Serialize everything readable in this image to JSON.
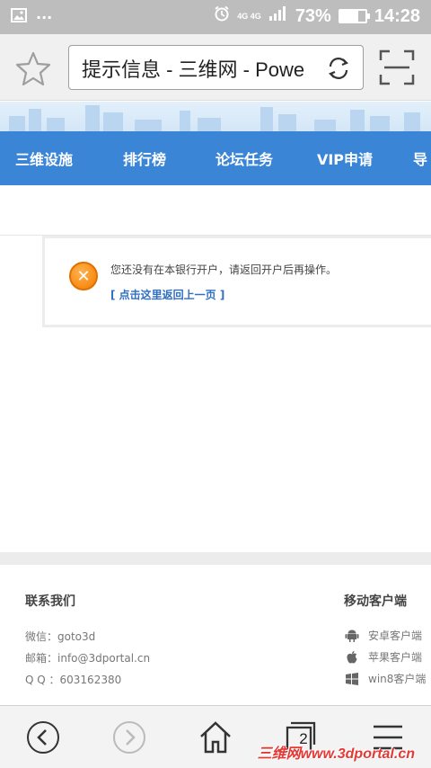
{
  "status": {
    "network": "4G 4G",
    "battery": "73%",
    "battery_level": 0.73,
    "time": "14:28"
  },
  "browser": {
    "title": "提示信息 - 三维网 - Powe",
    "tab_count": "2"
  },
  "nav": {
    "items": [
      "三维设施",
      "排行榜",
      "论坛任务",
      "VIP申请",
      "导"
    ]
  },
  "message": {
    "text": "您还没有在本银行开户，请返回开户后再操作。",
    "link": "[ 点击这里返回上一页 ]"
  },
  "footer": {
    "contact_title": "联系我们",
    "contacts": [
      "微信：goto3d",
      "邮箱：info@3dportal.cn",
      "Q Q ：603162380"
    ],
    "mobile_title": "移动客户端",
    "clients": [
      {
        "label": "安卓客户端",
        "icon": "android-icon"
      },
      {
        "label": "苹果客户端",
        "icon": "apple-icon"
      },
      {
        "label": "win8客户端",
        "icon": "windows-icon"
      }
    ]
  },
  "watermark": "三维网www.3dportal.cn",
  "colors": {
    "nav_blue": "#3a85d6",
    "link_blue": "#2f6fc4",
    "warning_orange": "#f57c00",
    "watermark_red": "#e53935"
  }
}
